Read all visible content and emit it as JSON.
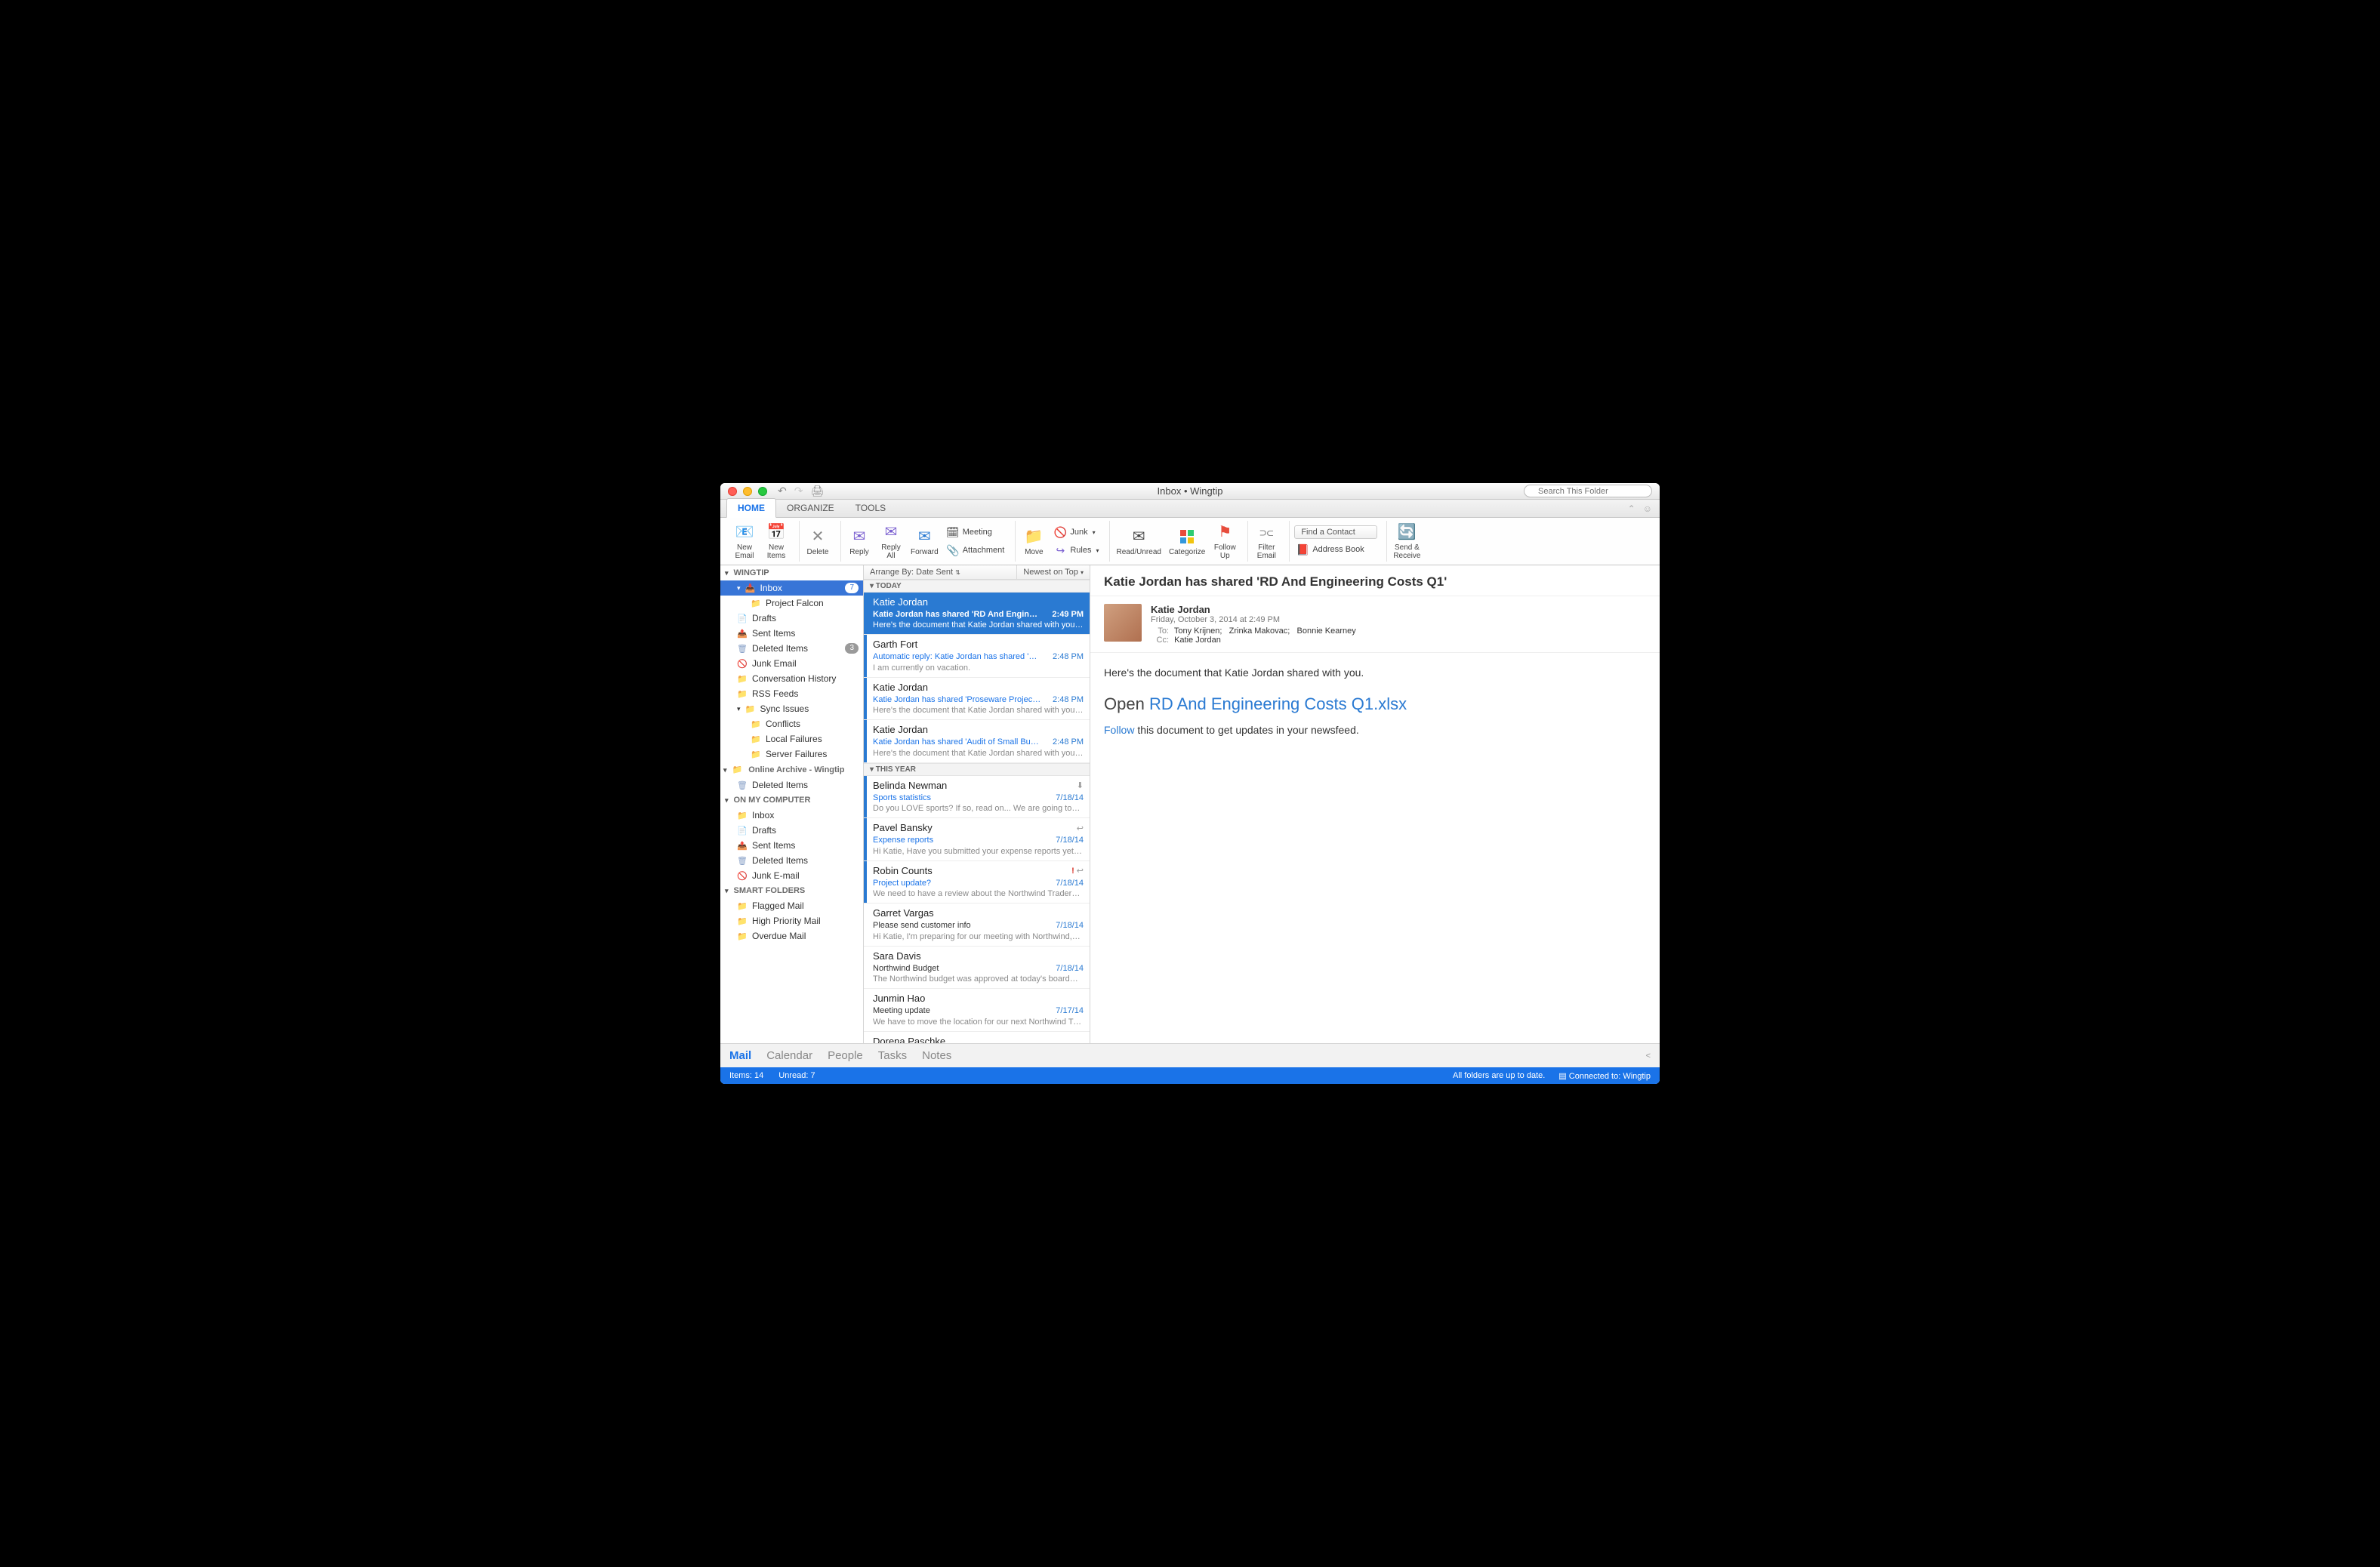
{
  "title": "Inbox • Wingtip",
  "search_placeholder": "Search This Folder",
  "tabs": {
    "home": "HOME",
    "organize": "ORGANIZE",
    "tools": "TOOLS"
  },
  "ribbon": {
    "new_email": "New\nEmail",
    "new_items": "New\nItems",
    "delete": "Delete",
    "reply": "Reply",
    "reply_all": "Reply\nAll",
    "forward": "Forward",
    "meeting": "Meeting",
    "attachment": "Attachment",
    "move": "Move",
    "junk": "Junk",
    "rules": "Rules",
    "read_unread": "Read/Unread",
    "categorize": "Categorize",
    "follow_up": "Follow\nUp",
    "filter_email": "Filter\nEmail",
    "find_contact": "Find a Contact",
    "address_book": "Address Book",
    "send_receive": "Send &\nReceive"
  },
  "sidebar": {
    "wingtip": "WINGTIP",
    "inbox": "Inbox",
    "inbox_badge": "7",
    "project_falcon": "Project Falcon",
    "drafts": "Drafts",
    "sent": "Sent Items",
    "deleted": "Deleted Items",
    "deleted_badge": "3",
    "junk": "Junk Email",
    "conv": "Conversation History",
    "rss": "RSS Feeds",
    "sync": "Sync Issues",
    "conflicts": "Conflicts",
    "localf": "Local Failures",
    "serverf": "Server Failures",
    "archive": "Online Archive - Wingtip",
    "arch_deleted": "Deleted Items",
    "onmy": "ON MY COMPUTER",
    "inbox2": "Inbox",
    "drafts2": "Drafts",
    "sent2": "Sent Items",
    "deleted2": "Deleted Items",
    "junk2": "Junk E-mail",
    "smart": "SMART FOLDERS",
    "flagged": "Flagged Mail",
    "highpri": "High Priority Mail",
    "overdue": "Overdue Mail"
  },
  "listbar": {
    "arrange": "Arrange By: Date Sent",
    "sort": "Newest on Top"
  },
  "groups": {
    "today": "TODAY",
    "thisyear": "THIS YEAR"
  },
  "messages": [
    {
      "from": "Katie Jordan",
      "subject": "Katie Jordan has shared 'RD And Engineeri…",
      "time": "2:49 PM",
      "preview": "Here's the document that Katie Jordan shared with you…",
      "selected": true,
      "unread": true
    },
    {
      "from": "Garth Fort",
      "subject": "Automatic reply: Katie Jordan has shared '…",
      "time": "2:48 PM",
      "preview": "I am currently on vacation.",
      "unread": true
    },
    {
      "from": "Katie Jordan",
      "subject": "Katie Jordan has shared 'Proseware Projec…",
      "time": "2:48 PM",
      "preview": "Here's the document that Katie Jordan shared with you…",
      "unread": true
    },
    {
      "from": "Katie Jordan",
      "subject": "Katie Jordan has shared 'Audit of Small Bu…",
      "time": "2:48 PM",
      "preview": "Here's the document that Katie Jordan shared with you…",
      "unread": true
    },
    {
      "from": "Belinda Newman",
      "subject": "Sports statistics",
      "time": "7/18/14",
      "preview": "Do you LOVE sports? If so, read on... We are going to…",
      "unread": true,
      "icons": [
        "down"
      ]
    },
    {
      "from": "Pavel Bansky",
      "subject": "Expense reports",
      "time": "7/18/14",
      "preview": "Hi Katie, Have you submitted your expense reports yet…",
      "unread": true,
      "icons": [
        "reply"
      ]
    },
    {
      "from": "Robin Counts",
      "subject": "Project update?",
      "time": "7/18/14",
      "preview": "We need to have a review about the Northwind Traders…",
      "unread": true,
      "icons": [
        "alert",
        "reply"
      ]
    },
    {
      "from": "Garret Vargas",
      "subject": "Please send customer info",
      "time": "7/18/14",
      "preview": "Hi Katie, I'm preparing for our meeting with Northwind,…",
      "blackread": true
    },
    {
      "from": "Sara Davis",
      "subject": "Northwind Budget",
      "time": "7/18/14",
      "preview": "The Northwind budget was approved at today's board…",
      "blackread": true
    },
    {
      "from": "Junmin Hao",
      "subject": "Meeting update",
      "time": "7/17/14",
      "preview": "We have to move the location for our next Northwind Tr…",
      "blackread": true
    },
    {
      "from": "Dorena Paschke",
      "subject": "",
      "time": "",
      "preview": "",
      "blackread": true
    }
  ],
  "reading": {
    "title": "Katie Jordan has shared 'RD And Engineering Costs Q1'",
    "from": "Katie Jordan",
    "date": "Friday, October 3, 2014 at 2:49 PM",
    "to_label": "To:",
    "to": [
      "Tony Krijnen;",
      "Zrinka Makovac;",
      "Bonnie Kearney"
    ],
    "cc_label": "Cc:",
    "cc": "Katie Jordan",
    "body_intro": "Here's the document that Katie Jordan shared with you.",
    "open_prefix": "Open ",
    "open_link": "RD And Engineering Costs Q1.xlsx",
    "follow_link": "Follow",
    "follow_rest": " this document to get updates in your newsfeed."
  },
  "nav": {
    "mail": "Mail",
    "calendar": "Calendar",
    "people": "People",
    "tasks": "Tasks",
    "notes": "Notes"
  },
  "status": {
    "items": "Items: 14",
    "unread": "Unread: 7",
    "folders": "All folders are up to date.",
    "connected": "Connected to: Wingtip"
  }
}
